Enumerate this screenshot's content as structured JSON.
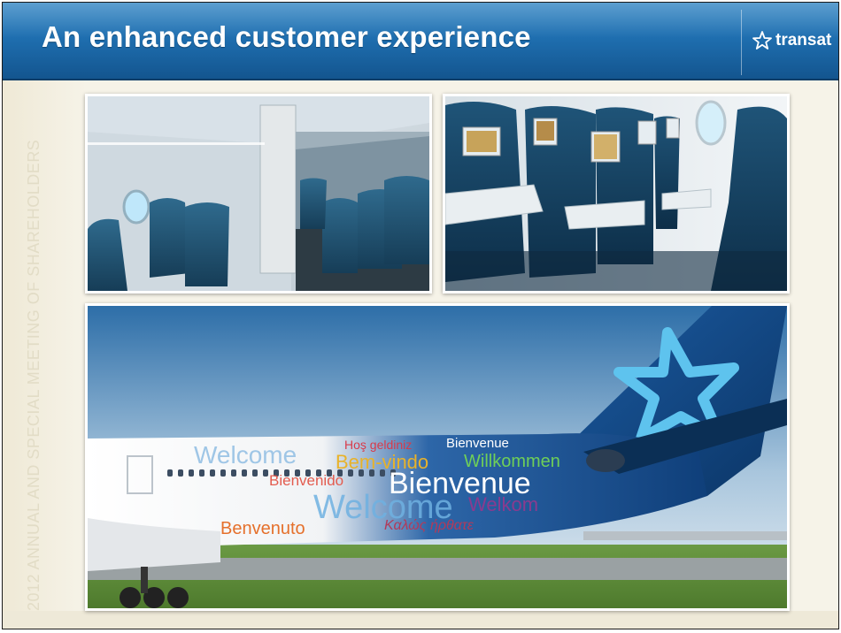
{
  "slide": {
    "title": "An enhanced customer experience",
    "logo_text": "transat",
    "side_text": "2012 ANNUAL AND SPECIAL MEETING OF SHAREHOLDERS"
  },
  "tail_words": {
    "w1": "Hoş geldiniz",
    "w2": "Bienvenue",
    "w3": "Welcome",
    "w4": "Bem-vindo",
    "w5": "Willkommen",
    "w6": "Bienvenido",
    "w7": "Bienvenue",
    "w8": "Welcome",
    "w9": "Welkom",
    "w10": "Benvenuto",
    "w11": "Καλώς ήρθατε"
  },
  "colors": {
    "header_blue": "#1f6fb0",
    "brand_star": "#5ec3ee",
    "tail_blue": "#0f4a8c"
  }
}
